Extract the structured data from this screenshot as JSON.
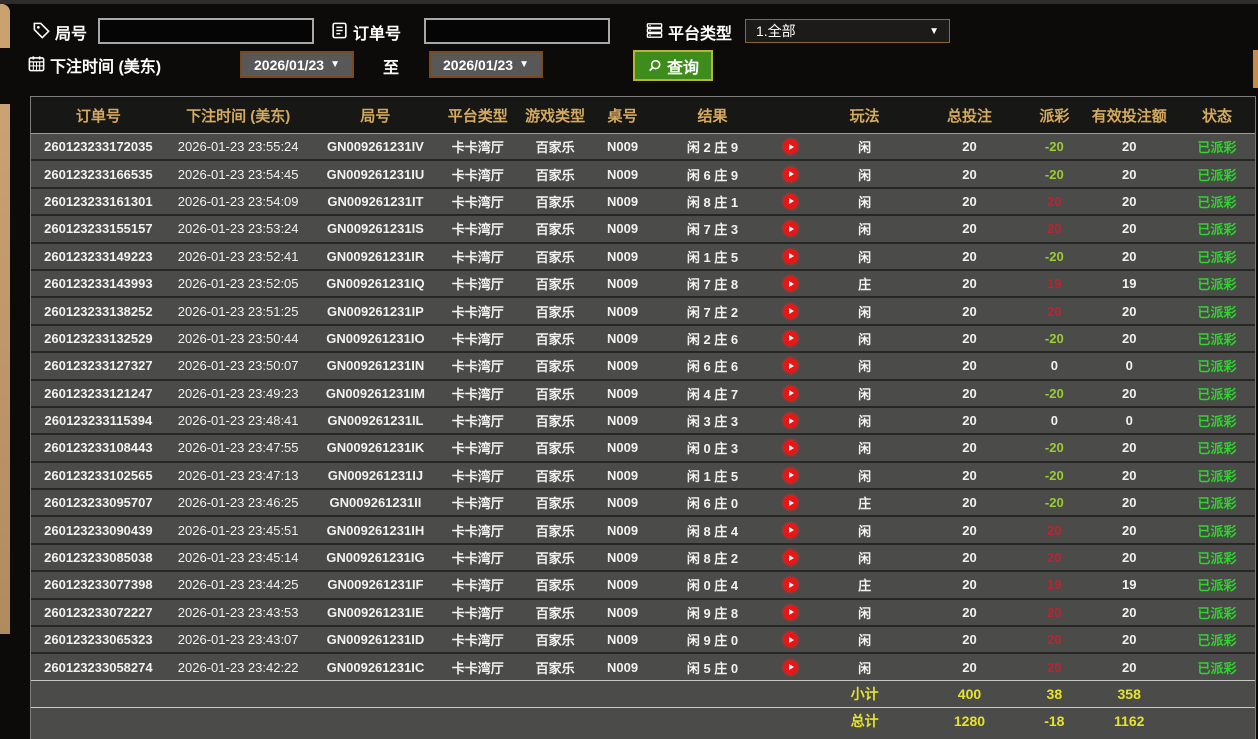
{
  "filters": {
    "round_label": "局号",
    "round_value": "",
    "order_label": "订单号",
    "order_value": "",
    "platform_label": "平台类型",
    "platform_value": "1.全部",
    "time_label": "下注时间 (美东)",
    "date_from": "2026/01/23",
    "to_label": "至",
    "date_to": "2026/01/23",
    "search_label": "查询"
  },
  "colors": {
    "header_gold": "#d4a960",
    "win_red": "#bd2330",
    "lose_green": "#9acd32",
    "status_green": "#2fd32f",
    "total_yellow": "#e6e32e",
    "button_green": "#3e8c1c"
  },
  "table": {
    "headers": [
      "订单号",
      "下注时间 (美东)",
      "局号",
      "平台类型",
      "游戏类型",
      "桌号",
      "结果",
      "玩法",
      "总投注",
      "派彩",
      "有效投注额",
      "状态"
    ],
    "rows": [
      {
        "order": "260123233172035",
        "time": "2026-01-23 23:55:24",
        "round": "GN009261231IV",
        "platform": "卡卡湾厅",
        "game": "百家乐",
        "table": "N009",
        "result": "闲 2 庄 9",
        "play": "闲",
        "bet": "20",
        "payout": "-20",
        "payout_color": "green",
        "valid": "20",
        "status": "已派彩"
      },
      {
        "order": "260123233166535",
        "time": "2026-01-23 23:54:45",
        "round": "GN009261231IU",
        "platform": "卡卡湾厅",
        "game": "百家乐",
        "table": "N009",
        "result": "闲 6 庄 9",
        "play": "闲",
        "bet": "20",
        "payout": "-20",
        "payout_color": "green",
        "valid": "20",
        "status": "已派彩"
      },
      {
        "order": "260123233161301",
        "time": "2026-01-23 23:54:09",
        "round": "GN009261231IT",
        "platform": "卡卡湾厅",
        "game": "百家乐",
        "table": "N009",
        "result": "闲 8 庄 1",
        "play": "闲",
        "bet": "20",
        "payout": "20",
        "payout_color": "red",
        "valid": "20",
        "status": "已派彩"
      },
      {
        "order": "260123233155157",
        "time": "2026-01-23 23:53:24",
        "round": "GN009261231IS",
        "platform": "卡卡湾厅",
        "game": "百家乐",
        "table": "N009",
        "result": "闲 7 庄 3",
        "play": "闲",
        "bet": "20",
        "payout": "20",
        "payout_color": "red",
        "valid": "20",
        "status": "已派彩"
      },
      {
        "order": "260123233149223",
        "time": "2026-01-23 23:52:41",
        "round": "GN009261231IR",
        "platform": "卡卡湾厅",
        "game": "百家乐",
        "table": "N009",
        "result": "闲 1 庄 5",
        "play": "闲",
        "bet": "20",
        "payout": "-20",
        "payout_color": "green",
        "valid": "20",
        "status": "已派彩"
      },
      {
        "order": "260123233143993",
        "time": "2026-01-23 23:52:05",
        "round": "GN009261231IQ",
        "platform": "卡卡湾厅",
        "game": "百家乐",
        "table": "N009",
        "result": "闲 7 庄 8",
        "play": "庄",
        "bet": "20",
        "payout": "19",
        "payout_color": "red",
        "valid": "19",
        "status": "已派彩"
      },
      {
        "order": "260123233138252",
        "time": "2026-01-23 23:51:25",
        "round": "GN009261231IP",
        "platform": "卡卡湾厅",
        "game": "百家乐",
        "table": "N009",
        "result": "闲 7 庄 2",
        "play": "闲",
        "bet": "20",
        "payout": "20",
        "payout_color": "red",
        "valid": "20",
        "status": "已派彩"
      },
      {
        "order": "260123233132529",
        "time": "2026-01-23 23:50:44",
        "round": "GN009261231IO",
        "platform": "卡卡湾厅",
        "game": "百家乐",
        "table": "N009",
        "result": "闲 2 庄 6",
        "play": "闲",
        "bet": "20",
        "payout": "-20",
        "payout_color": "green",
        "valid": "20",
        "status": "已派彩"
      },
      {
        "order": "260123233127327",
        "time": "2026-01-23 23:50:07",
        "round": "GN009261231IN",
        "platform": "卡卡湾厅",
        "game": "百家乐",
        "table": "N009",
        "result": "闲 6 庄 6",
        "play": "闲",
        "bet": "20",
        "payout": "0",
        "payout_color": "white",
        "valid": "0",
        "status": "已派彩"
      },
      {
        "order": "260123233121247",
        "time": "2026-01-23 23:49:23",
        "round": "GN009261231IM",
        "platform": "卡卡湾厅",
        "game": "百家乐",
        "table": "N009",
        "result": "闲 4 庄 7",
        "play": "闲",
        "bet": "20",
        "payout": "-20",
        "payout_color": "green",
        "valid": "20",
        "status": "已派彩"
      },
      {
        "order": "260123233115394",
        "time": "2026-01-23 23:48:41",
        "round": "GN009261231IL",
        "platform": "卡卡湾厅",
        "game": "百家乐",
        "table": "N009",
        "result": "闲 3 庄 3",
        "play": "闲",
        "bet": "20",
        "payout": "0",
        "payout_color": "white",
        "valid": "0",
        "status": "已派彩"
      },
      {
        "order": "260123233108443",
        "time": "2026-01-23 23:47:55",
        "round": "GN009261231IK",
        "platform": "卡卡湾厅",
        "game": "百家乐",
        "table": "N009",
        "result": "闲 0 庄 3",
        "play": "闲",
        "bet": "20",
        "payout": "-20",
        "payout_color": "green",
        "valid": "20",
        "status": "已派彩"
      },
      {
        "order": "260123233102565",
        "time": "2026-01-23 23:47:13",
        "round": "GN009261231IJ",
        "platform": "卡卡湾厅",
        "game": "百家乐",
        "table": "N009",
        "result": "闲 1 庄 5",
        "play": "闲",
        "bet": "20",
        "payout": "-20",
        "payout_color": "green",
        "valid": "20",
        "status": "已派彩"
      },
      {
        "order": "260123233095707",
        "time": "2026-01-23 23:46:25",
        "round": "GN009261231II",
        "platform": "卡卡湾厅",
        "game": "百家乐",
        "table": "N009",
        "result": "闲 6 庄 0",
        "play": "庄",
        "bet": "20",
        "payout": "-20",
        "payout_color": "green",
        "valid": "20",
        "status": "已派彩"
      },
      {
        "order": "260123233090439",
        "time": "2026-01-23 23:45:51",
        "round": "GN009261231IH",
        "platform": "卡卡湾厅",
        "game": "百家乐",
        "table": "N009",
        "result": "闲 8 庄 4",
        "play": "闲",
        "bet": "20",
        "payout": "20",
        "payout_color": "red",
        "valid": "20",
        "status": "已派彩"
      },
      {
        "order": "260123233085038",
        "time": "2026-01-23 23:45:14",
        "round": "GN009261231IG",
        "platform": "卡卡湾厅",
        "game": "百家乐",
        "table": "N009",
        "result": "闲 8 庄 2",
        "play": "闲",
        "bet": "20",
        "payout": "20",
        "payout_color": "red",
        "valid": "20",
        "status": "已派彩"
      },
      {
        "order": "260123233077398",
        "time": "2026-01-23 23:44:25",
        "round": "GN009261231IF",
        "platform": "卡卡湾厅",
        "game": "百家乐",
        "table": "N009",
        "result": "闲 0 庄 4",
        "play": "庄",
        "bet": "20",
        "payout": "19",
        "payout_color": "red",
        "valid": "19",
        "status": "已派彩"
      },
      {
        "order": "260123233072227",
        "time": "2026-01-23 23:43:53",
        "round": "GN009261231IE",
        "platform": "卡卡湾厅",
        "game": "百家乐",
        "table": "N009",
        "result": "闲 9 庄 8",
        "play": "闲",
        "bet": "20",
        "payout": "20",
        "payout_color": "red",
        "valid": "20",
        "status": "已派彩"
      },
      {
        "order": "260123233065323",
        "time": "2026-01-23 23:43:07",
        "round": "GN009261231ID",
        "platform": "卡卡湾厅",
        "game": "百家乐",
        "table": "N009",
        "result": "闲 9 庄 0",
        "play": "闲",
        "bet": "20",
        "payout": "20",
        "payout_color": "red",
        "valid": "20",
        "status": "已派彩"
      },
      {
        "order": "260123233058274",
        "time": "2026-01-23 23:42:22",
        "round": "GN009261231IC",
        "platform": "卡卡湾厅",
        "game": "百家乐",
        "table": "N009",
        "result": "闲 5 庄 0",
        "play": "闲",
        "bet": "20",
        "payout": "20",
        "payout_color": "red",
        "valid": "20",
        "status": "已派彩"
      }
    ],
    "subtotal": {
      "label": "小计",
      "bet": "400",
      "payout": "38",
      "valid": "358"
    },
    "total": {
      "label": "总计",
      "bet": "1280",
      "payout": "-18",
      "valid": "1162"
    }
  }
}
